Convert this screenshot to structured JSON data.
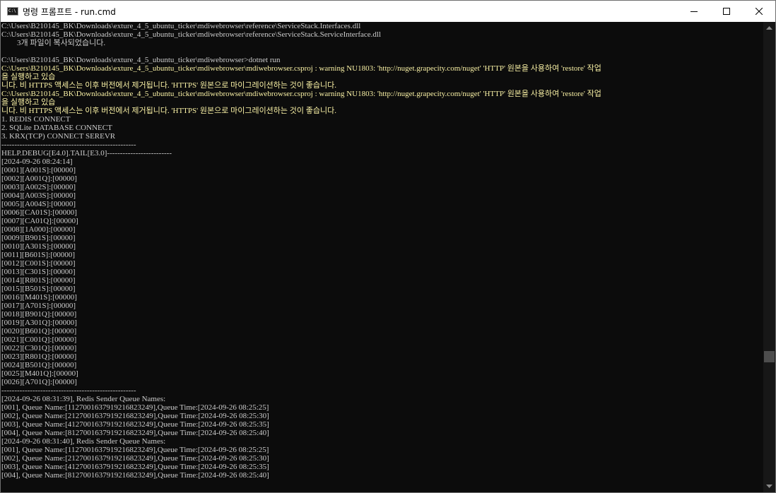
{
  "window": {
    "title": "명령 프롬프트 - run.cmd",
    "icon": "cmd-icon",
    "icon_text": "C:\\"
  },
  "colors": {
    "default_text": "#cccccc",
    "warning_text": "#f9f1a5",
    "background": "#0c0c0c"
  },
  "console": {
    "lines": [
      {
        "text": "C:\\Users\\B210145_BK\\Downloads\\exture_4_5_ubuntu_ticker\\mdiwebrowser\\reference\\ServiceStack.Interfaces.dll",
        "style": "normal"
      },
      {
        "text": "C:\\Users\\B210145_BK\\Downloads\\exture_4_5_ubuntu_ticker\\mdiwebrowser\\reference\\ServiceStack.ServiceInterface.dll",
        "style": "normal"
      },
      {
        "text": "        3개 파일이 복사되었습니다.",
        "style": "normal"
      },
      {
        "text": "",
        "style": "normal"
      },
      {
        "text": "C:\\Users\\B210145_BK\\Downloads\\exture_4_5_ubuntu_ticker\\mdiwebrowser>dotnet run",
        "style": "normal"
      },
      {
        "text": "C:\\Users\\B210145_BK\\Downloads\\exture_4_5_ubuntu_ticker\\mdiwebrowser\\mdiwebrowser.csproj : warning NU1803: 'http://nuget.grapecity.com/nuget' 'HTTP' 원본을 사용하여 'restore' 작업",
        "style": "warning"
      },
      {
        "text": "을 실행하고 있습",
        "style": "warning"
      },
      {
        "text": "니다. 비 HTTPS 액세스는 이후 버전에서 제거됩니다. 'HTTPS' 원본으로 마이그레이션하는 것이 좋습니다.",
        "style": "warning"
      },
      {
        "text": "C:\\Users\\B210145_BK\\Downloads\\exture_4_5_ubuntu_ticker\\mdiwebrowser\\mdiwebrowser.csproj : warning NU1803: 'http://nuget.grapecity.com/nuget' 'HTTP' 원본을 사용하여 'restore' 작업",
        "style": "warning"
      },
      {
        "text": "을 실행하고 있습",
        "style": "warning"
      },
      {
        "text": "니다. 비 HTTPS 액세스는 이후 버전에서 제거됩니다. 'HTTPS' 원본으로 마이그레이션하는 것이 좋습니다.",
        "style": "warning"
      },
      {
        "text": "1. REDIS CONNECT",
        "style": "normal"
      },
      {
        "text": "2. SQLite DATABASE CONNECT",
        "style": "normal"
      },
      {
        "text": "3. KRX(TCP) CONNECT SEREVR",
        "style": "normal"
      },
      {
        "text": "----------------------------------------------------",
        "style": "normal"
      },
      {
        "text": "HELP.DEBUG[E4.0].TAIL[E3.0]-------------------------",
        "style": "normal"
      },
      {
        "text": "[2024-09-26 08:24:14]",
        "style": "normal"
      },
      {
        "text": "[0001][A001S]:[00000]",
        "style": "normal"
      },
      {
        "text": "[0002][A001Q]:[00000]",
        "style": "normal"
      },
      {
        "text": "[0003][A002S]:[00000]",
        "style": "normal"
      },
      {
        "text": "[0004][A003S]:[00000]",
        "style": "normal"
      },
      {
        "text": "[0005][A004S]:[00000]",
        "style": "normal"
      },
      {
        "text": "[0006][CA01S]:[00000]",
        "style": "normal"
      },
      {
        "text": "[0007][CA01Q]:[00000]",
        "style": "normal"
      },
      {
        "text": "[0008][1A000]:[00000]",
        "style": "normal"
      },
      {
        "text": "[0009][B901S]:[00000]",
        "style": "normal"
      },
      {
        "text": "[0010][A301S]:[00000]",
        "style": "normal"
      },
      {
        "text": "[0011][B601S]:[00000]",
        "style": "normal"
      },
      {
        "text": "[0012][C001S]:[00000]",
        "style": "normal"
      },
      {
        "text": "[0013][C301S]:[00000]",
        "style": "normal"
      },
      {
        "text": "[0014][R801S]:[00000]",
        "style": "normal"
      },
      {
        "text": "[0015][B501S]:[00000]",
        "style": "normal"
      },
      {
        "text": "[0016][M401S]:[00000]",
        "style": "normal"
      },
      {
        "text": "[0017][A701S]:[00000]",
        "style": "normal"
      },
      {
        "text": "[0018][B901Q]:[00000]",
        "style": "normal"
      },
      {
        "text": "[0019][A301Q]:[00000]",
        "style": "normal"
      },
      {
        "text": "[0020][B601Q]:[00000]",
        "style": "normal"
      },
      {
        "text": "[0021][C001Q]:[00000]",
        "style": "normal"
      },
      {
        "text": "[0022][C301Q]:[00000]",
        "style": "normal"
      },
      {
        "text": "[0023][R801Q]:[00000]",
        "style": "normal"
      },
      {
        "text": "[0024][B501Q]:[00000]",
        "style": "normal"
      },
      {
        "text": "[0025][M401Q]:[00000]",
        "style": "normal"
      },
      {
        "text": "[0026][A701Q]:[00000]",
        "style": "normal"
      },
      {
        "text": "----------------------------------------------------",
        "style": "normal"
      },
      {
        "text": "[2024-09-26 08:31:39], Redis Sender Queue Names:",
        "style": "normal"
      },
      {
        "text": "[001], Queue Name:[1127001637919216823249],Queue Time:[2024-09-26 08:25:25]",
        "style": "normal"
      },
      {
        "text": "[002], Queue Name:[2127001637919216823249],Queue Time:[2024-09-26 08:25:30]",
        "style": "normal"
      },
      {
        "text": "[003], Queue Name:[4127001637919216823249],Queue Time:[2024-09-26 08:25:35]",
        "style": "normal"
      },
      {
        "text": "[004], Queue Name:[8127001637919216823249],Queue Time:[2024-09-26 08:25:40]",
        "style": "normal"
      },
      {
        "text": "[2024-09-26 08:31:40], Redis Sender Queue Names:",
        "style": "normal"
      },
      {
        "text": "[001], Queue Name:[1127001637919216823249],Queue Time:[2024-09-26 08:25:25]",
        "style": "normal"
      },
      {
        "text": "[002], Queue Name:[2127001637919216823249],Queue Time:[2024-09-26 08:25:30]",
        "style": "normal"
      },
      {
        "text": "[003], Queue Name:[4127001637919216823249],Queue Time:[2024-09-26 08:25:35]",
        "style": "normal"
      },
      {
        "text": "[004], Queue Name:[8127001637919216823249],Queue Time:[2024-09-26 08:25:40]",
        "style": "normal"
      }
    ]
  }
}
